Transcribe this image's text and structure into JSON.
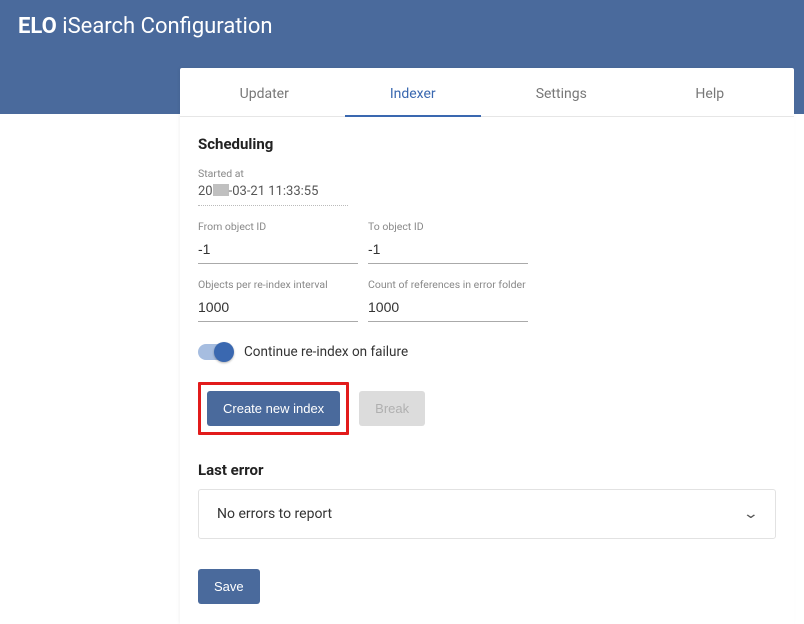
{
  "header": {
    "brand": "ELO",
    "title": "iSearch Configuration"
  },
  "tabs": {
    "updater": "Updater",
    "indexer": "Indexer",
    "settings": "Settings",
    "help": "Help"
  },
  "scheduling": {
    "title": "Scheduling",
    "started_label": "Started at",
    "started_prefix": "20",
    "started_suffix": "-03-21 11:33:55",
    "from_id_label": "From object ID",
    "from_id_value": "-1",
    "to_id_label": "To object ID",
    "to_id_value": "-1",
    "objects_label": "Objects per re-index interval",
    "objects_value": "1000",
    "refs_label": "Count of references in error folder",
    "refs_value": "1000",
    "continue_label": "Continue re-index on failure",
    "create_btn": "Create new index",
    "break_btn": "Break"
  },
  "last_error": {
    "title": "Last error",
    "message": "No errors to report"
  },
  "footer": {
    "save": "Save"
  }
}
